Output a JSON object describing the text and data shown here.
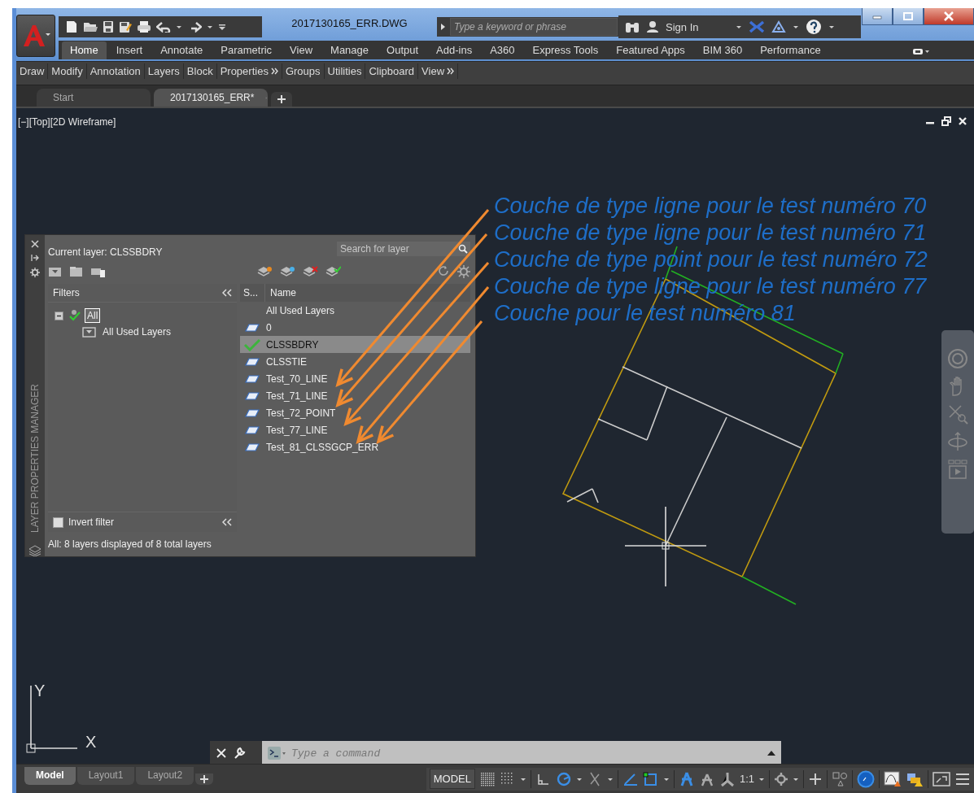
{
  "window": {
    "title": "2017130165_ERR.DWG"
  },
  "search": {
    "placeholder": "Type a keyword or phrase"
  },
  "account": {
    "label": "Sign In"
  },
  "ribbon_tabs": [
    {
      "label": "Home",
      "selected": true
    },
    {
      "label": "Insert",
      "selected": false
    },
    {
      "label": "Annotate",
      "selected": false
    },
    {
      "label": "Parametric",
      "selected": false
    },
    {
      "label": "View",
      "selected": false
    },
    {
      "label": "Manage",
      "selected": false
    },
    {
      "label": "Output",
      "selected": false
    },
    {
      "label": "Add-ins",
      "selected": false
    },
    {
      "label": "A360",
      "selected": false
    },
    {
      "label": "Express Tools",
      "selected": false
    },
    {
      "label": "Featured Apps",
      "selected": false
    },
    {
      "label": "BIM 360",
      "selected": false
    },
    {
      "label": "Performance",
      "selected": false
    }
  ],
  "ribbon_panels": [
    {
      "label": "Draw",
      "more": false
    },
    {
      "label": "Modify",
      "more": false
    },
    {
      "label": "Annotation",
      "more": false
    },
    {
      "label": "Layers",
      "more": false
    },
    {
      "label": "Block",
      "more": false
    },
    {
      "label": "Properties",
      "more": true
    },
    {
      "label": "Groups",
      "more": false
    },
    {
      "label": "Utilities",
      "more": false
    },
    {
      "label": "Clipboard",
      "more": false
    },
    {
      "label": "View",
      "more": true
    }
  ],
  "file_tabs": [
    {
      "label": "Start",
      "selected": false,
      "closable": false
    },
    {
      "label": "2017130165_ERR*",
      "selected": true,
      "closable": true
    }
  ],
  "viewport": {
    "label": "[−][Top][2D Wireframe]"
  },
  "layer_palette": {
    "title": "LAYER PROPERTIES MANAGER",
    "current_layer": "Current layer: CLSSBDRY",
    "search_placeholder": "Search for layer",
    "filters": {
      "heading": "Filters",
      "tree": [
        {
          "label": "All",
          "selected": true,
          "expanded": true,
          "children": [
            {
              "label": "All Used Layers",
              "selected": false
            }
          ]
        }
      ],
      "invert_filter": {
        "label": "Invert filter",
        "checked": false
      }
    },
    "columns": [
      "S...",
      "Name"
    ],
    "layers": [
      {
        "name": "All Used Layers",
        "kind": "filter",
        "selected": false
      },
      {
        "name": "0",
        "kind": "layer",
        "current": false,
        "selected": false
      },
      {
        "name": "CLSSBDRY",
        "kind": "layer",
        "current": true,
        "selected": true
      },
      {
        "name": "CLSSTIE",
        "kind": "layer",
        "current": false,
        "selected": false
      },
      {
        "name": "Test_70_LINE",
        "kind": "layer",
        "current": false,
        "selected": false
      },
      {
        "name": "Test_71_LINE",
        "kind": "layer",
        "current": false,
        "selected": false
      },
      {
        "name": "Test_72_POINT",
        "kind": "layer",
        "current": false,
        "selected": false
      },
      {
        "name": "Test_77_LINE",
        "kind": "layer",
        "current": false,
        "selected": false
      },
      {
        "name": "Test_81_CLSSGCP_ERR",
        "kind": "layer",
        "current": false,
        "selected": false
      }
    ],
    "status": "All: 8 layers displayed of 8 total layers"
  },
  "annotations": [
    "Couche de type ligne pour le test numéro 70",
    "Couche de type ligne pour le test numéro 71",
    "Couche de type point pour le test numéro 72",
    "Couche de type ligne pour le test numéro 77",
    "Couche pour le test numéro 81"
  ],
  "ucs": {
    "x_label": "X",
    "y_label": "Y"
  },
  "command_line": {
    "placeholder": "Type a command"
  },
  "layout_tabs": [
    {
      "label": "Model",
      "selected": true
    },
    {
      "label": "Layout1",
      "selected": false
    },
    {
      "label": "Layout2",
      "selected": false
    }
  ],
  "status_bar": {
    "space": "MODEL",
    "scale": "1:1"
  }
}
